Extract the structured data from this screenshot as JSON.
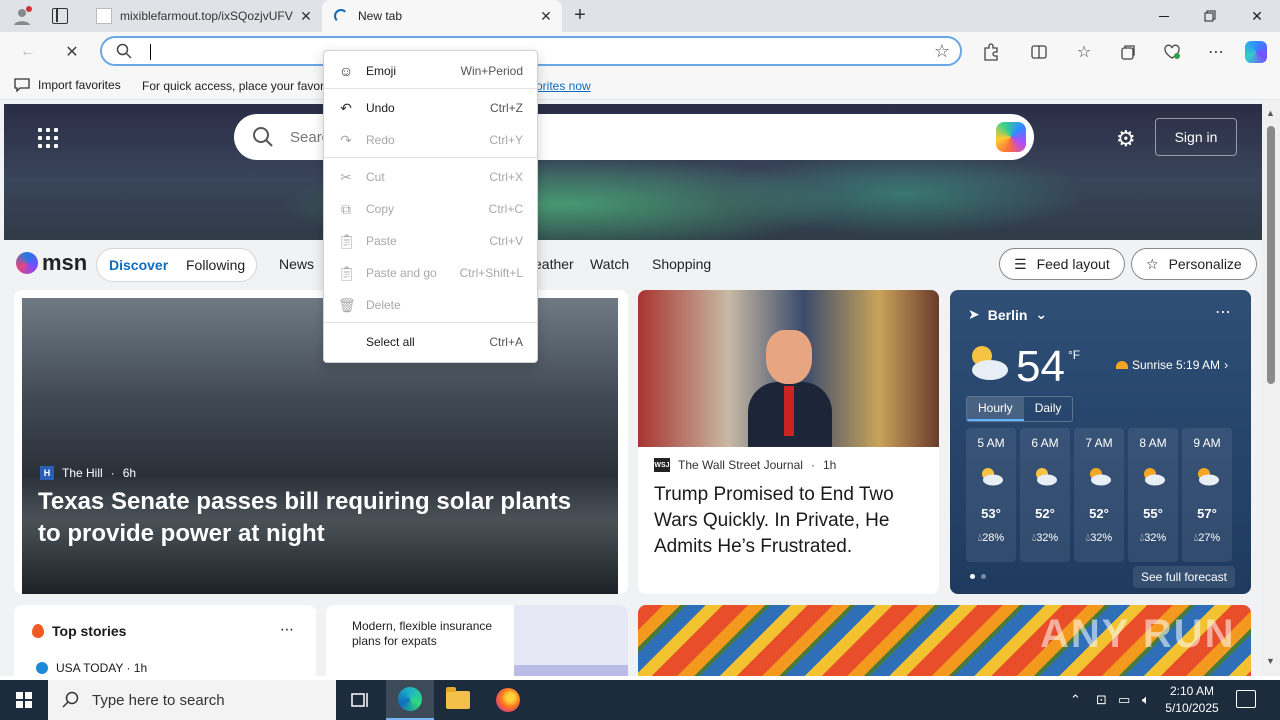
{
  "browser": {
    "tabs": [
      {
        "title": "mixiblefarmout.top/ixSQozjvUFV",
        "active": false
      },
      {
        "title": "New tab",
        "active": true
      }
    ],
    "address_bar": {
      "value": "",
      "placeholder": ""
    },
    "favorites_bar": {
      "import_label": "Import favorites",
      "hint": "For quick access, place your favori",
      "link_label": "orites now"
    }
  },
  "context_menu": {
    "items": [
      {
        "icon": "emoji-icon",
        "label": "Emoji",
        "shortcut": "Win+Period",
        "enabled": true
      },
      {
        "icon": "undo-icon",
        "label": "Undo",
        "shortcut": "Ctrl+Z",
        "enabled": true
      },
      {
        "icon": "redo-icon",
        "label": "Redo",
        "shortcut": "Ctrl+Y",
        "enabled": false
      },
      {
        "icon": "cut-icon",
        "label": "Cut",
        "shortcut": "Ctrl+X",
        "enabled": false
      },
      {
        "icon": "copy-icon",
        "label": "Copy",
        "shortcut": "Ctrl+C",
        "enabled": false
      },
      {
        "icon": "paste-icon",
        "label": "Paste",
        "shortcut": "Ctrl+V",
        "enabled": false
      },
      {
        "icon": "paste-and-go-icon",
        "label": "Paste and go",
        "shortcut": "Ctrl+Shift+L",
        "enabled": false
      },
      {
        "icon": "delete-icon",
        "label": "Delete",
        "shortcut": "",
        "enabled": false
      },
      {
        "icon": "",
        "label": "Select all",
        "shortcut": "Ctrl+A",
        "enabled": true
      }
    ]
  },
  "msn": {
    "search_placeholder": "Searc",
    "sign_in": "Sign in",
    "logo_text": "msn",
    "nav": {
      "discover": "Discover",
      "following": "Following",
      "news": "News",
      "weather_partial": "eather",
      "watch": "Watch",
      "shopping": "Shopping"
    },
    "feed_layout": "Feed layout",
    "personalize": "Personalize",
    "lead_story": {
      "source": "The Hill",
      "age": "6h",
      "source_logo": "H",
      "headline": "Texas Senate passes bill requiring solar plants to provide power at night"
    },
    "second_story": {
      "source": "The Wall Street Journal",
      "age": "1h",
      "source_logo": "WSJ",
      "headline": "Trump Promised to End Two Wars Quickly. In Private, He Admits He’s Frustrated."
    },
    "weather": {
      "city": "Berlin",
      "temp": "54",
      "unit": "°F",
      "sunrise": "Sunrise 5:19 AM",
      "tab_hourly": "Hourly",
      "tab_daily": "Daily",
      "hours": [
        {
          "time": "5 AM",
          "temp": "53°",
          "rain": "28%",
          "icon": "partly-cloudy-night-icon"
        },
        {
          "time": "6 AM",
          "temp": "52°",
          "rain": "32%",
          "icon": "partly-cloudy-night-icon"
        },
        {
          "time": "7 AM",
          "temp": "52°",
          "rain": "32%",
          "icon": "partly-sunny-icon"
        },
        {
          "time": "8 AM",
          "temp": "55°",
          "rain": "32%",
          "icon": "partly-sunny-icon"
        },
        {
          "time": "9 AM",
          "temp": "57°",
          "rain": "27%",
          "icon": "partly-sunny-icon"
        }
      ],
      "forecast_link": "See full forecast"
    },
    "top_stories": {
      "title": "Top stories",
      "first_source": "USA TODAY · 1h"
    },
    "ad": {
      "text": "Modern, flexible insurance plans for expats"
    },
    "watermark": "ANY RUN"
  },
  "taskbar": {
    "search_placeholder": "Type here to search",
    "time": "2:10 AM",
    "date": "5/10/2025"
  }
}
